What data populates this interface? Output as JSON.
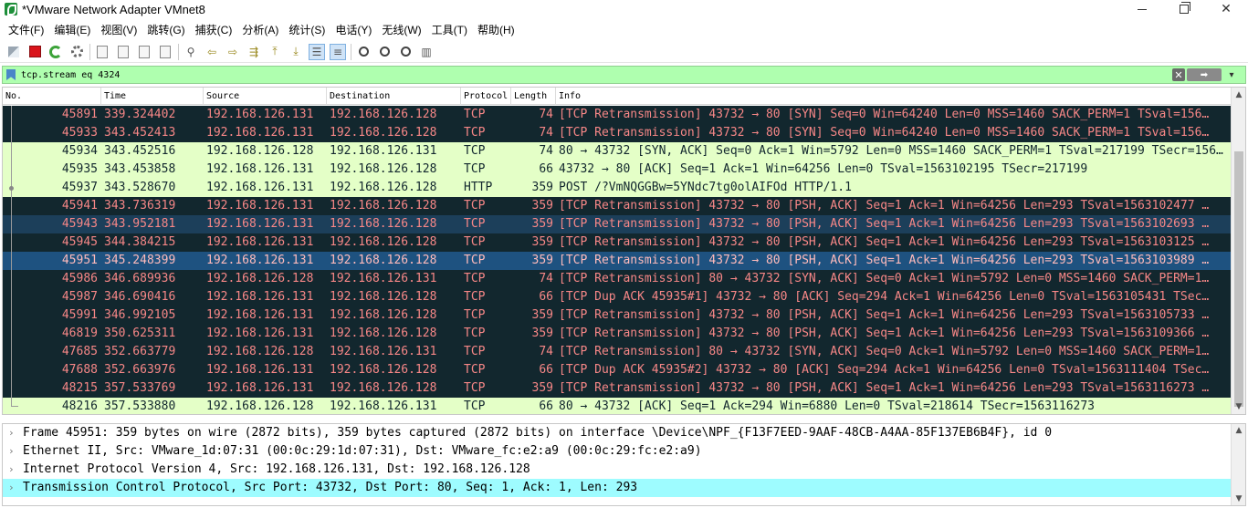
{
  "window": {
    "title": "*VMware Network Adapter VMnet8",
    "minimize": "—",
    "close": "✕"
  },
  "menu": [
    "文件(F)",
    "编辑(E)",
    "视图(V)",
    "跳转(G)",
    "捕获(C)",
    "分析(A)",
    "统计(S)",
    "电话(Y)",
    "无线(W)",
    "工具(T)",
    "帮助(H)"
  ],
  "filter": {
    "text": "tcp.stream eq 4324",
    "clear": "✕",
    "apply": "➡",
    "dropdown": "▾"
  },
  "columns": [
    "No.",
    "Time",
    "Source",
    "Destination",
    "Protocol",
    "Length",
    "Info"
  ],
  "packets": [
    {
      "no": "45891",
      "time": "339.324402",
      "src": "192.168.126.131",
      "dst": "192.168.126.128",
      "proto": "TCP",
      "len": "74",
      "info": "[TCP Retransmission] 43732 → 80 [SYN] Seq=0 Win=64240 Len=0 MSS=1460 SACK_PERM=1 TSval=156…"
    },
    {
      "no": "45933",
      "time": "343.452413",
      "src": "192.168.126.131",
      "dst": "192.168.126.128",
      "proto": "TCP",
      "len": "74",
      "info": "[TCP Retransmission] 43732 → 80 [SYN] Seq=0 Win=64240 Len=0 MSS=1460 SACK_PERM=1 TSval=156…"
    },
    {
      "no": "45934",
      "time": "343.452516",
      "src": "192.168.126.128",
      "dst": "192.168.126.131",
      "proto": "TCP",
      "len": "74",
      "info": "80 → 43732 [SYN, ACK] Seq=0 Ack=1 Win=5792 Len=0 MSS=1460 SACK_PERM=1 TSval=217199 TSecr=156…"
    },
    {
      "no": "45935",
      "time": "343.453858",
      "src": "192.168.126.131",
      "dst": "192.168.126.128",
      "proto": "TCP",
      "len": "66",
      "info": "43732 → 80 [ACK] Seq=1 Ack=1 Win=64256 Len=0 TSval=1563102195 TSecr=217199"
    },
    {
      "no": "45937",
      "time": "343.528670",
      "src": "192.168.126.131",
      "dst": "192.168.126.128",
      "proto": "HTTP",
      "len": "359",
      "info": "POST /?VmNQGGBw=5YNdc7tg0olAIFOd HTTP/1.1"
    },
    {
      "no": "45941",
      "time": "343.736319",
      "src": "192.168.126.131",
      "dst": "192.168.126.128",
      "proto": "TCP",
      "len": "359",
      "info": "[TCP Retransmission] 43732 → 80 [PSH, ACK] Seq=1 Ack=1 Win=64256 Len=293 TSval=1563102477 …"
    },
    {
      "no": "45943",
      "time": "343.952181",
      "src": "192.168.126.131",
      "dst": "192.168.126.128",
      "proto": "TCP",
      "len": "359",
      "info": "[TCP Retransmission] 43732 → 80 [PSH, ACK] Seq=1 Ack=1 Win=64256 Len=293 TSval=1563102693 …"
    },
    {
      "no": "45945",
      "time": "344.384215",
      "src": "192.168.126.131",
      "dst": "192.168.126.128",
      "proto": "TCP",
      "len": "359",
      "info": "[TCP Retransmission] 43732 → 80 [PSH, ACK] Seq=1 Ack=1 Win=64256 Len=293 TSval=1563103125 …"
    },
    {
      "no": "45951",
      "time": "345.248399",
      "src": "192.168.126.131",
      "dst": "192.168.126.128",
      "proto": "TCP",
      "len": "359",
      "info": "[TCP Retransmission] 43732 → 80 [PSH, ACK] Seq=1 Ack=1 Win=64256 Len=293 TSval=1563103989 …"
    },
    {
      "no": "45986",
      "time": "346.689936",
      "src": "192.168.126.128",
      "dst": "192.168.126.131",
      "proto": "TCP",
      "len": "74",
      "info": "[TCP Retransmission] 80 → 43732 [SYN, ACK] Seq=0 Ack=1 Win=5792 Len=0 MSS=1460 SACK_PERM=1…"
    },
    {
      "no": "45987",
      "time": "346.690416",
      "src": "192.168.126.131",
      "dst": "192.168.126.128",
      "proto": "TCP",
      "len": "66",
      "info": "[TCP Dup ACK 45935#1] 43732 → 80 [ACK] Seq=294 Ack=1 Win=64256 Len=0 TSval=1563105431 TSec…"
    },
    {
      "no": "45991",
      "time": "346.992105",
      "src": "192.168.126.131",
      "dst": "192.168.126.128",
      "proto": "TCP",
      "len": "359",
      "info": "[TCP Retransmission] 43732 → 80 [PSH, ACK] Seq=1 Ack=1 Win=64256 Len=293 TSval=1563105733 …"
    },
    {
      "no": "46819",
      "time": "350.625311",
      "src": "192.168.126.131",
      "dst": "192.168.126.128",
      "proto": "TCP",
      "len": "359",
      "info": "[TCP Retransmission] 43732 → 80 [PSH, ACK] Seq=1 Ack=1 Win=64256 Len=293 TSval=1563109366 …"
    },
    {
      "no": "47685",
      "time": "352.663779",
      "src": "192.168.126.128",
      "dst": "192.168.126.131",
      "proto": "TCP",
      "len": "74",
      "info": "[TCP Retransmission] 80 → 43732 [SYN, ACK] Seq=0 Ack=1 Win=5792 Len=0 MSS=1460 SACK_PERM=1…"
    },
    {
      "no": "47688",
      "time": "352.663976",
      "src": "192.168.126.131",
      "dst": "192.168.126.128",
      "proto": "TCP",
      "len": "66",
      "info": "[TCP Dup ACK 45935#2] 43732 → 80 [ACK] Seq=294 Ack=1 Win=64256 Len=0 TSval=1563111404 TSec…"
    },
    {
      "no": "48215",
      "time": "357.533769",
      "src": "192.168.126.131",
      "dst": "192.168.126.128",
      "proto": "TCP",
      "len": "359",
      "info": "[TCP Retransmission] 43732 → 80 [PSH, ACK] Seq=1 Ack=1 Win=64256 Len=293 TSval=1563116273 …"
    },
    {
      "no": "48216",
      "time": "357.533880",
      "src": "192.168.126.128",
      "dst": "192.168.126.131",
      "proto": "TCP",
      "len": "66",
      "info": "80 → 43732 [ACK] Seq=1 Ack=294 Win=6880 Len=0 TSval=218614 TSecr=1563116273"
    }
  ],
  "row_styles": [
    "dark",
    "dark",
    "light",
    "light",
    "light",
    "dark",
    "dark selblue",
    "dark",
    "dark selfocus",
    "dark",
    "dark",
    "dark",
    "dark",
    "dark",
    "dark",
    "dark",
    "light"
  ],
  "details": [
    "Frame 45951: 359 bytes on wire (2872 bits), 359 bytes captured (2872 bits) on interface \\Device\\NPF_{F13F7EED-9AAF-48CB-A4AA-85F137EB6B4F}, id 0",
    "Ethernet II, Src: VMware_1d:07:31 (00:0c:29:1d:07:31), Dst: VMware_fc:e2:a9 (00:0c:29:fc:e2:a9)",
    "Internet Protocol Version 4, Src: 192.168.126.131, Dst: 192.168.126.128",
    "Transmission Control Protocol, Src Port: 43732, Dst Port: 80, Seq: 1, Ack: 1, Len: 293"
  ],
  "colors": {
    "dark_row_bg": "#12272e",
    "dark_row_fg": "#f78787",
    "light_row_bg": "#e4ffc7",
    "filter_bg": "#afffaf",
    "detail_selected": "#9efcff"
  }
}
